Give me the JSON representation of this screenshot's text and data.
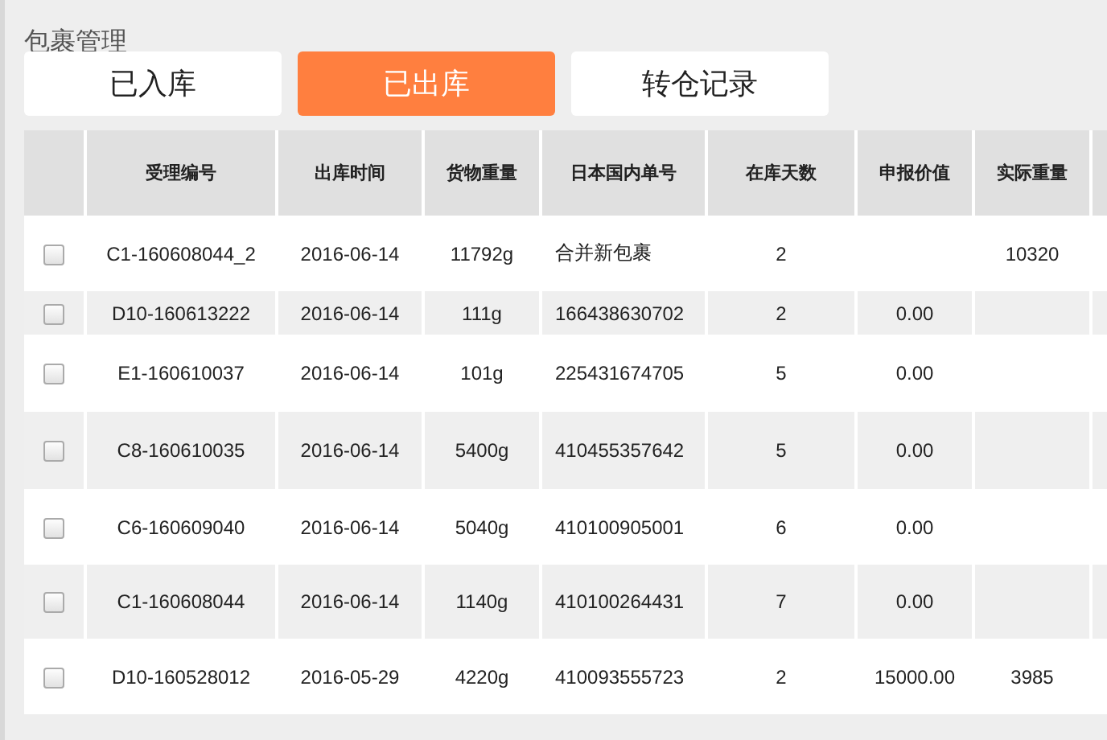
{
  "title": "包裹管理",
  "tabs": [
    {
      "label": "已入库",
      "selected": false
    },
    {
      "label": "已出库",
      "selected": true
    },
    {
      "label": "转仓记录",
      "selected": false
    }
  ],
  "table": {
    "columns": [
      "受理编号",
      "出库时间",
      "货物重量",
      "日本国内单号",
      "在库天数",
      "申报价值",
      "实际重量"
    ],
    "rows": [
      {
        "checked": false,
        "cells": [
          "C1-160608044_2",
          "2016-06-14",
          "11792g",
          "合并新包裹",
          "2",
          "",
          "10320"
        ]
      },
      {
        "checked": false,
        "cells": [
          "D10-160613222",
          "2016-06-14",
          "111g",
          "166438630702",
          "2",
          "0.00",
          ""
        ]
      },
      {
        "checked": false,
        "cells": [
          "E1-160610037",
          "2016-06-14",
          "101g",
          "225431674705",
          "5",
          "0.00",
          ""
        ]
      },
      {
        "checked": false,
        "cells": [
          "C8-160610035",
          "2016-06-14",
          "5400g",
          "410455357642",
          "5",
          "0.00",
          ""
        ]
      },
      {
        "checked": false,
        "cells": [
          "C6-160609040",
          "2016-06-14",
          "5040g",
          "410100905001",
          "6",
          "0.00",
          ""
        ]
      },
      {
        "checked": false,
        "cells": [
          "C1-160608044",
          "2016-06-14",
          "1140g",
          "410100264431",
          "7",
          "0.00",
          ""
        ]
      },
      {
        "checked": false,
        "cells": [
          "D10-160528012",
          "2016-05-29",
          "4220g",
          "410093555723",
          "2",
          "15000.00",
          "3985"
        ]
      }
    ]
  }
}
